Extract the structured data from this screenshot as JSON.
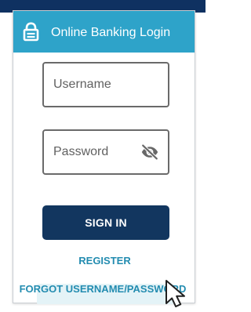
{
  "header": {
    "title": "Online Banking Login",
    "lock_icon": "lock-icon"
  },
  "form": {
    "username": {
      "placeholder": "Username",
      "value": ""
    },
    "password": {
      "placeholder": "Password",
      "value": "",
      "visibility_icon": "eye-slash-icon"
    },
    "sign_in_label": "SIGN IN"
  },
  "links": {
    "register": "REGISTER",
    "forgot_username_password": "FORGOT USERNAME/PASSWORD"
  },
  "colors": {
    "top_band": "#0f3161",
    "header_accent": "#2ea3c9",
    "button": "#12365f",
    "link": "#238cb0",
    "hover_highlight": "#e4f3f7"
  }
}
